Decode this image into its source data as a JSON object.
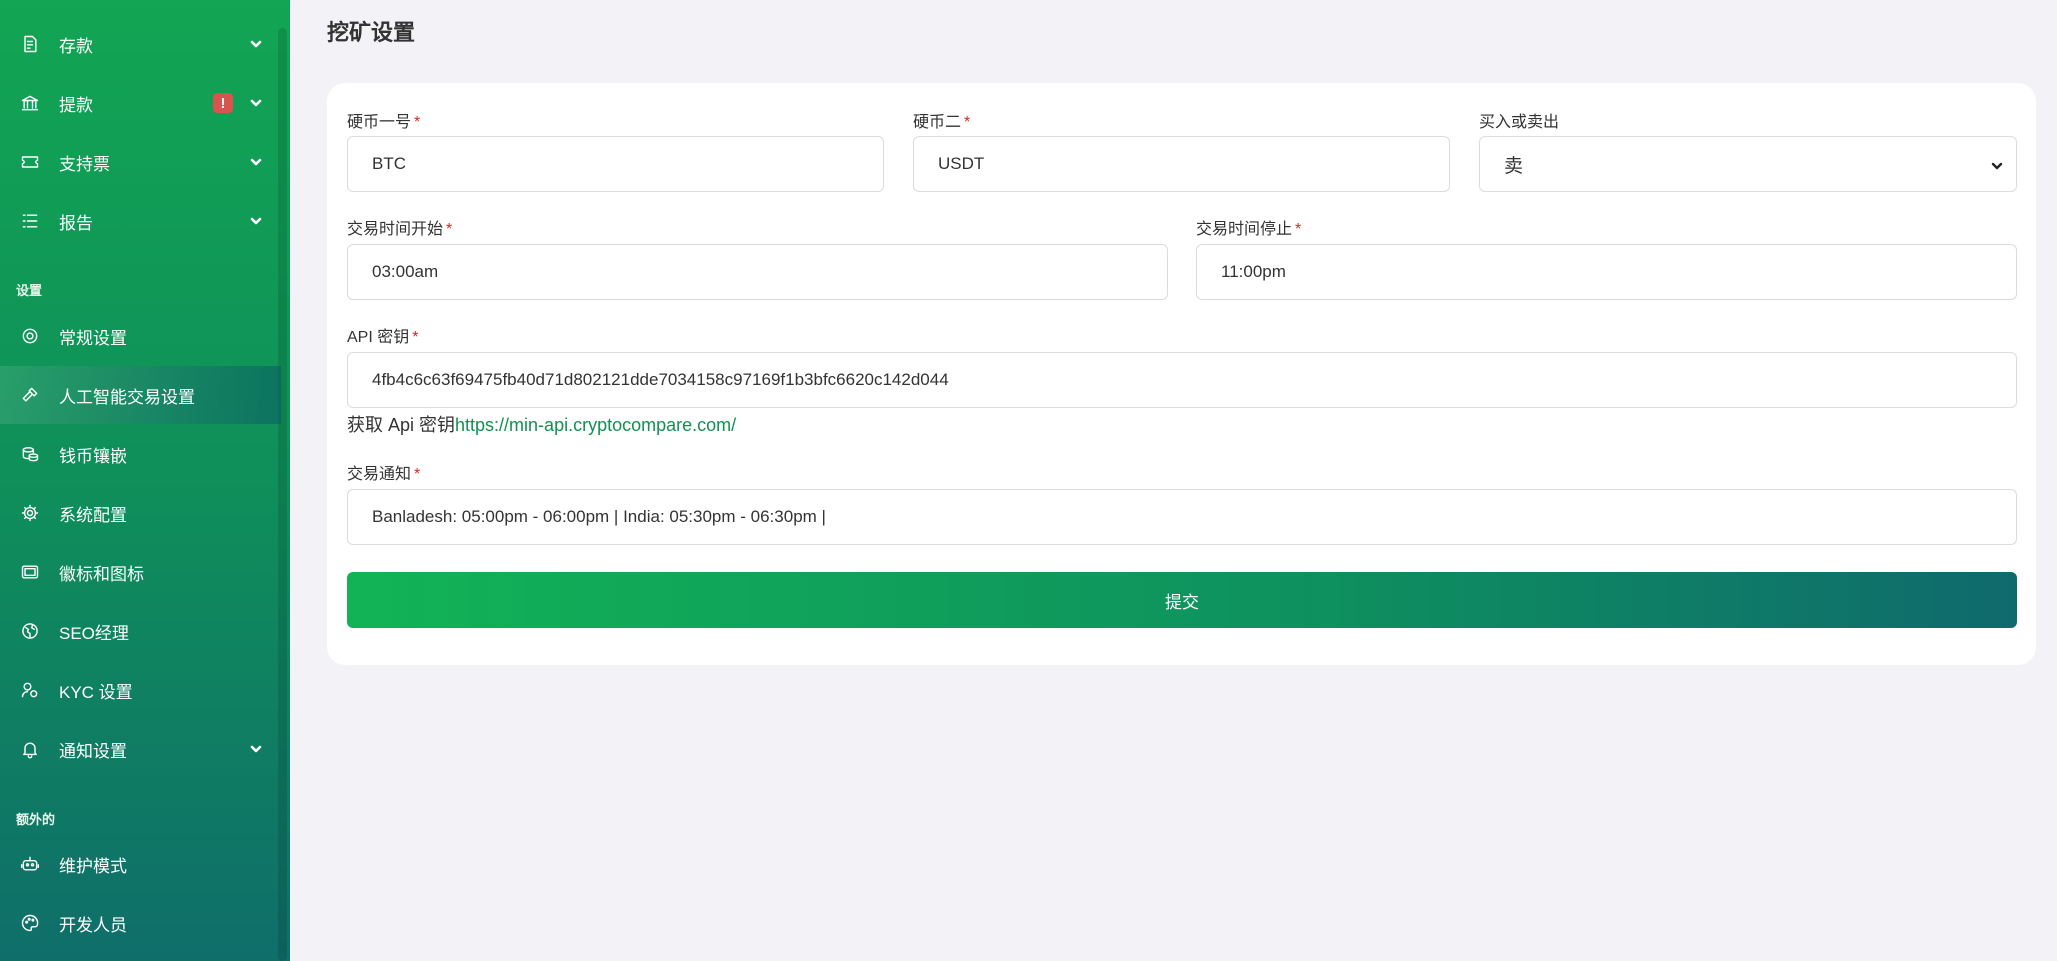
{
  "sidebar": {
    "items": [
      {
        "label": "存款",
        "icon": "deposit-icon"
      },
      {
        "label": "提款",
        "icon": "bank-icon",
        "badge": "!"
      },
      {
        "label": "支持票",
        "icon": "ticket-icon"
      },
      {
        "label": "报告",
        "icon": "list-icon"
      }
    ],
    "section_settings": "设置",
    "settings_items": [
      {
        "label": "常规设置",
        "icon": "lifebuoy-icon"
      },
      {
        "label": "人工智能交易设置",
        "icon": "hammer-icon"
      },
      {
        "label": "钱币镶嵌",
        "icon": "coins-icon"
      },
      {
        "label": "系统配置",
        "icon": "gear-icon"
      },
      {
        "label": "徽标和图标",
        "icon": "image-icon"
      },
      {
        "label": "SEO经理",
        "icon": "globe-icon"
      },
      {
        "label": "KYC 设置",
        "icon": "user-check-icon"
      },
      {
        "label": "通知设置",
        "icon": "bell-icon"
      }
    ],
    "section_extra": "额外的",
    "extra_items": [
      {
        "label": "维护模式",
        "icon": "robot-icon"
      },
      {
        "label": "开发人员",
        "icon": "palette-icon"
      }
    ]
  },
  "page": {
    "title": "挖矿设置"
  },
  "form": {
    "coin_one": {
      "label": "硬币一号",
      "required": "*",
      "value": "BTC"
    },
    "coin_two": {
      "label": "硬币二",
      "required": "*",
      "value": "USDT"
    },
    "buy_sell": {
      "label": "买入或卖出",
      "value": "卖"
    },
    "time_start": {
      "label": "交易时间开始",
      "required": "*",
      "value": "03:00am"
    },
    "time_stop": {
      "label": "交易时间停止",
      "required": "*",
      "value": "11:00pm"
    },
    "api_key": {
      "label": "API 密钥",
      "required": "*",
      "value": "4fb4c6c63f69475fb40d71d802121dde7034158c97169f1b3bfc6620c142d044"
    },
    "api_help_text": "获取 Api 密钥",
    "api_help_link": "https://min-api.cryptocompare.com/",
    "notice": {
      "label": "交易通知",
      "required": "*",
      "value": "Banladesh: 05:00pm - 06:00pm | India: 05:30pm - 06:30pm |"
    },
    "submit_label": "提交"
  },
  "colors": {
    "sidebar_green": "#12a553",
    "sidebar_teal": "#0f6e6a",
    "required_red": "#e02424",
    "link_green": "#11914f",
    "badge_red": "#d9534f"
  }
}
